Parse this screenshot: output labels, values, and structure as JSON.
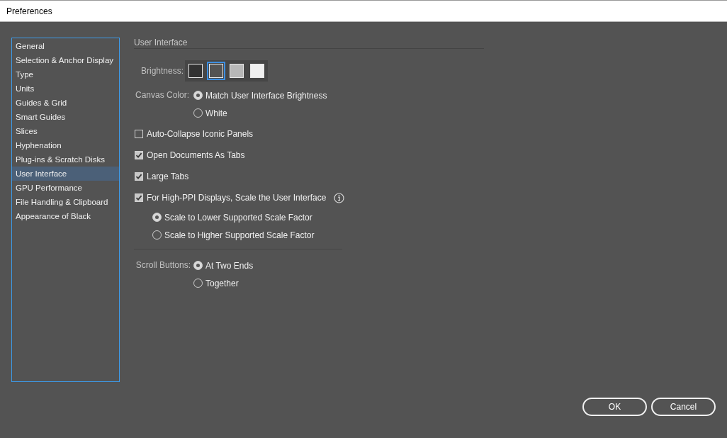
{
  "window": {
    "title": "Preferences"
  },
  "sidebar": {
    "items": [
      {
        "label": "General",
        "selected": false
      },
      {
        "label": "Selection & Anchor Display",
        "selected": false
      },
      {
        "label": "Type",
        "selected": false
      },
      {
        "label": "Units",
        "selected": false
      },
      {
        "label": "Guides & Grid",
        "selected": false
      },
      {
        "label": "Smart Guides",
        "selected": false
      },
      {
        "label": "Slices",
        "selected": false
      },
      {
        "label": "Hyphenation",
        "selected": false
      },
      {
        "label": "Plug-ins & Scratch Disks",
        "selected": false
      },
      {
        "label": "User Interface",
        "selected": true
      },
      {
        "label": "GPU Performance",
        "selected": false
      },
      {
        "label": "File Handling & Clipboard",
        "selected": false
      },
      {
        "label": "Appearance of Black",
        "selected": false
      }
    ]
  },
  "section_title": "User Interface",
  "brightness": {
    "label": "Brightness:",
    "swatches": [
      {
        "color": "#323232",
        "selected": false
      },
      {
        "color": "#535353",
        "selected": true
      },
      {
        "color": "#b8b8b8",
        "selected": false
      },
      {
        "color": "#f0f0f0",
        "selected": false
      }
    ]
  },
  "canvas_color": {
    "label": "Canvas Color:",
    "options": [
      {
        "label": "Match User Interface Brightness",
        "selected": true
      },
      {
        "label": "White",
        "selected": false
      }
    ]
  },
  "checkboxes": [
    {
      "label": "Auto-Collapse Iconic Panels",
      "checked": false,
      "has_info": false
    },
    {
      "label": "Open Documents As Tabs",
      "checked": true,
      "has_info": false
    },
    {
      "label": "Large Tabs",
      "checked": true,
      "has_info": false
    },
    {
      "label": "For High-PPI Displays, Scale the User Interface",
      "checked": true,
      "has_info": true
    }
  ],
  "scale_options": [
    {
      "label": "Scale to Lower Supported Scale Factor",
      "selected": true
    },
    {
      "label": "Scale to Higher Supported Scale Factor",
      "selected": false
    }
  ],
  "scroll_buttons": {
    "label": "Scroll Buttons:",
    "options": [
      {
        "label": "At Two Ends",
        "selected": true
      },
      {
        "label": "Together",
        "selected": false
      }
    ]
  },
  "buttons": [
    "OK",
    "Cancel"
  ]
}
